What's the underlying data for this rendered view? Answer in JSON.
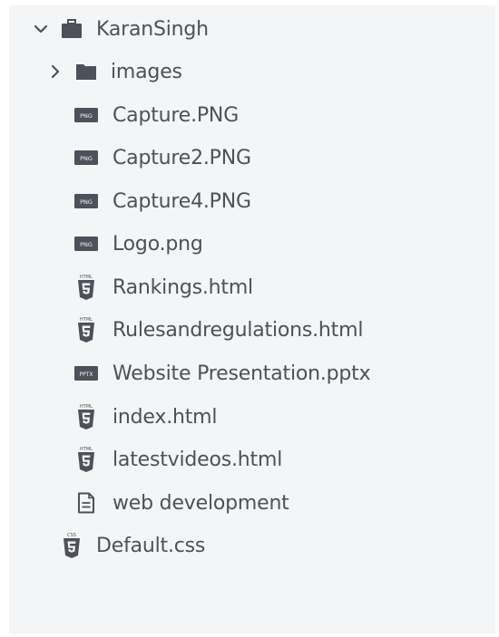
{
  "tree": {
    "root": {
      "label": "KaranSingh",
      "expanded": true
    },
    "images_folder": {
      "label": "images",
      "expanded": false
    },
    "files": [
      {
        "label": "Capture.PNG",
        "type": "png"
      },
      {
        "label": "Capture2.PNG",
        "type": "png"
      },
      {
        "label": "Capture4.PNG",
        "type": "png"
      },
      {
        "label": "Logo.png",
        "type": "png"
      },
      {
        "label": "Rankings.html",
        "type": "html"
      },
      {
        "label": "Rulesandregulations.html",
        "type": "html"
      },
      {
        "label": "Website Presentation.pptx",
        "type": "pptx"
      },
      {
        "label": "index.html",
        "type": "html"
      },
      {
        "label": "latestvideos.html",
        "type": "html"
      },
      {
        "label": "web development",
        "type": "text"
      }
    ],
    "outside_file": {
      "label": "Default.css",
      "type": "css"
    }
  },
  "icons": {
    "png_badge": "PNG",
    "html_badge": "HTML",
    "css_badge": "CSS",
    "pptx_badge": "PPTX"
  },
  "colors": {
    "panel_bg": "#f4f5f6",
    "icon": "#4c515a",
    "text": "#4c515a"
  }
}
